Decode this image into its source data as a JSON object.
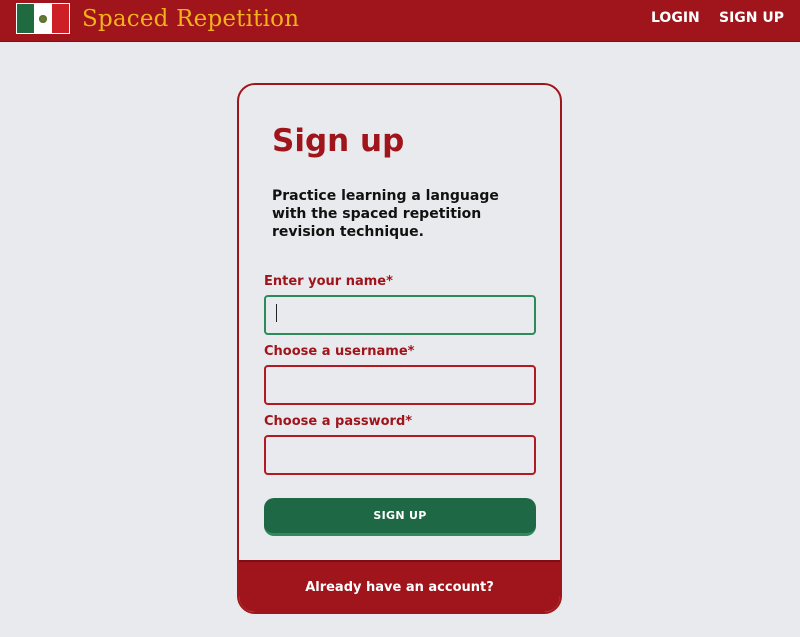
{
  "header": {
    "brand": "Spaced Repetition",
    "flag_icon": "mexico-flag-icon",
    "login_label": "LOGIN",
    "signup_label": "SIGN UP"
  },
  "colors": {
    "accent": "#a0141b",
    "brand_text": "#f2b21a",
    "button": "#1f6845",
    "background": "#e9eaed"
  },
  "card": {
    "title": "Sign up",
    "description": "Practice learning a language with the spaced repetition revision technique.",
    "fields": [
      {
        "label": "Enter your name*",
        "value": ""
      },
      {
        "label": "Choose a username*",
        "value": ""
      },
      {
        "label": "Choose a password*",
        "value": ""
      }
    ],
    "submit_label": "SIGN UP",
    "footer_link": "Already have an account?"
  }
}
